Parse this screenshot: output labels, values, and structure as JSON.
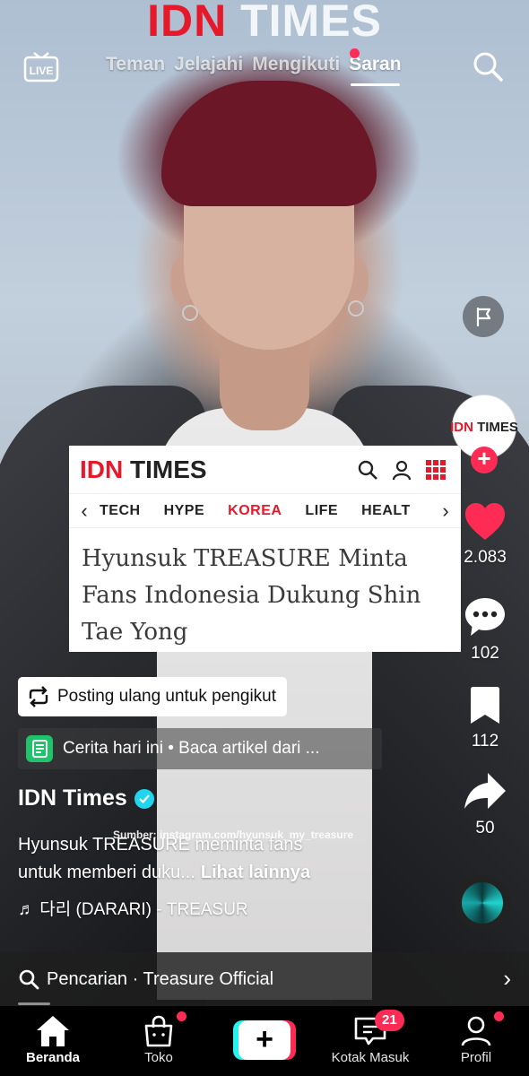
{
  "brand": {
    "logo_idn": "IDN",
    "logo_times": "TIMES"
  },
  "top_nav": {
    "live_label": "LIVE",
    "tabs": [
      "Teman",
      "Jelajahi",
      "Mengikuti",
      "Saran"
    ],
    "active_tab": "Saran"
  },
  "article": {
    "logo_idn": "IDN",
    "logo_times": "TIMES",
    "categories": [
      "TECH",
      "HYPE",
      "KOREA",
      "LIFE",
      "HEALT"
    ],
    "active_category": "KOREA",
    "title": "Hyunsuk TREASURE Minta Fans Indonesia Dukung Shin Tae Yong"
  },
  "right_rail": {
    "avatar_idn": "IDN",
    "avatar_times": "TIMES",
    "likes": "2.083",
    "comments": "102",
    "bookmarks": "112",
    "shares": "50"
  },
  "post": {
    "repost_label": "Posting ulang untuk pengikut",
    "story_label": "Cerita hari ini • Baca artikel dari ...",
    "author": "IDN Times",
    "caption_line1": "Hyunsuk TREASURE meminta fans",
    "caption_line2": "untuk memberi duku...",
    "see_more": "Lihat lainnya",
    "source": "Sumber: instagram.com/hyunsuk_my_treasure",
    "music": "♬ 다리 (DARARI) - TREASUR"
  },
  "search_bar": {
    "label": "Pencarian · Treasure Official"
  },
  "bottom_nav": {
    "items": [
      "Beranda",
      "Toko",
      "",
      "Kotak Masuk",
      "Profil"
    ],
    "inbox_count": "21"
  },
  "colors": {
    "accent": "#fe2c55",
    "brand_red": "#e6192a",
    "teal": "#25f4ee"
  }
}
